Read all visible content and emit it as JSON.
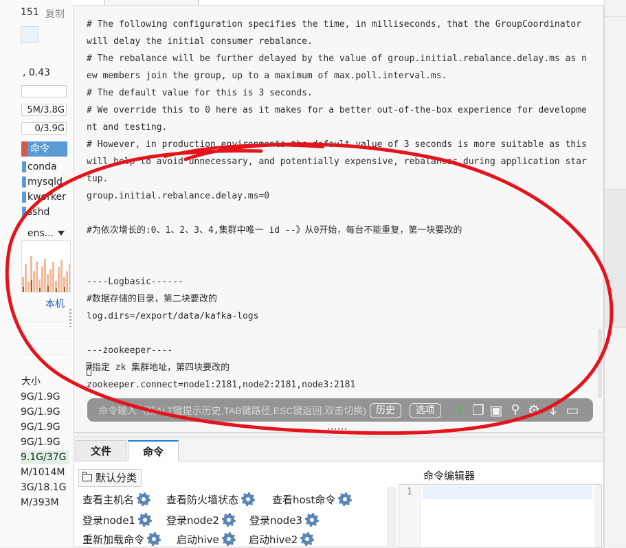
{
  "sidebar": {
    "top_number": "151",
    "copy_label": "复制",
    "load": ", 0.43",
    "mem": "5M/3.8G",
    "swap": "0/3.9G",
    "cmd_header": "命令",
    "processes": [
      "conda",
      "mysqld",
      "kworker",
      "sshd"
    ],
    "net_interface": "ens...",
    "local_label": "本机",
    "size_header": "大小",
    "disks": [
      "9G/1.9G",
      "9G/1.9G",
      "9G/1.9G",
      "9G/1.9G",
      "9.1G/37G",
      "M/1014M",
      "3G/18.1G",
      "M/393M"
    ]
  },
  "terminal": {
    "lines": [
      "# The following configuration specifies the time, in milliseconds, that the GroupCoordinator will delay the initial consumer rebalance.",
      "# The rebalance will be further delayed by the value of group.initial.rebalance.delay.ms as new members join the group, up to a maximum of max.poll.interval.ms.",
      "# The default value for this is 3 seconds.",
      "# We override this to 0 here as it makes for a better out-of-the-box experience for development and testing.",
      "# However, in production environments the default value of 3 seconds is more suitable as this will help to avoid unnecessary, and potentially expensive, rebalances during application startup.",
      "group.initial.rebalance.delay.ms=0",
      "",
      "#为依次增长的:0、1、2、3、4,集群中唯一 id --》从0开始，每台不能重复，第一块要改的",
      "",
      "",
      "----Logbasic------",
      "#数据存储的目录，第二块要改的",
      "log.dirs=/export/data/kafka-logs",
      "",
      "---zookeeper----",
      "#指定 zk 集群地址，第四块要改的",
      "zookeeper.connect=node1:2181,node2:2181,node3:2181"
    ]
  },
  "command_bar": {
    "placeholder": "命令输入（按ALT键提示历史,TAB键路径,ESC键返回,双击切换)",
    "history_label": "历史",
    "options_label": "选项"
  },
  "bottom_panel": {
    "tabs": [
      {
        "label": "文件",
        "active": false
      },
      {
        "label": "命令",
        "active": true
      }
    ],
    "category_label": "默认分类",
    "commands": [
      [
        "查看主机名",
        "查看防火墙状态",
        "查看host命令"
      ],
      [
        "登录node1",
        "登录node2",
        "登录node3"
      ],
      [
        "重新加载命令",
        "启动hive",
        "启动hive2"
      ]
    ],
    "editor_title": "命令编辑器",
    "editor_line_number": "1"
  },
  "colors": {
    "accent_blue": "#1f7fd6",
    "annotation_red": "#e3141b",
    "lightning_green": "#3ec63e"
  }
}
